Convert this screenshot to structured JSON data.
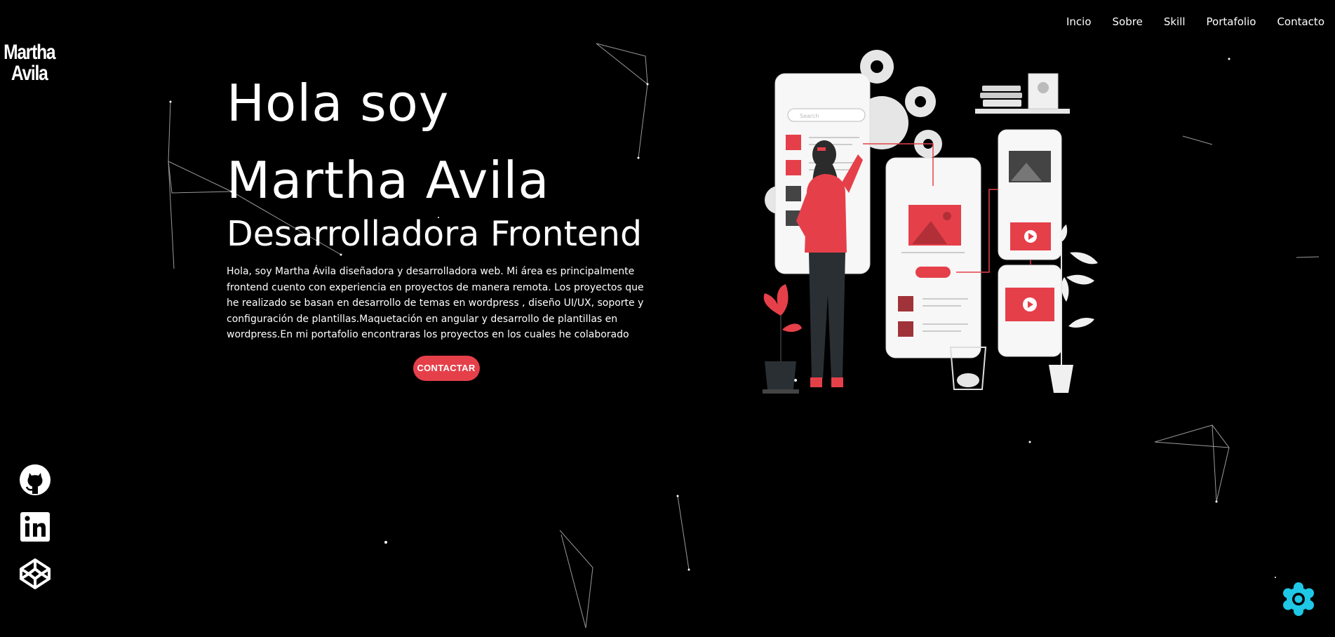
{
  "logo": {
    "line1": "Martha",
    "line2": "Avila"
  },
  "nav": {
    "items": [
      {
        "label": "Incio"
      },
      {
        "label": "Sobre"
      },
      {
        "label": "Skill"
      },
      {
        "label": "Portafolio"
      },
      {
        "label": "Contacto"
      }
    ]
  },
  "hero": {
    "title": "Hola soy Martha Avila",
    "subtitle": "Desarrolladora Frontend",
    "description": "Hola, soy Martha Ávila diseñadora y desarrolladora web. Mi área es principalmente frontend cuento con experiencia en proyectos de manera remota. Los proyectos que he realizado se basan en desarrollo de temas en wordpress , diseño UI/UX, soporte y configuración de plantillas.Maquetación en angular y desarrollo de plantillas en wordpress.En mi portafolio encontraras los proyectos en los cuales he colaborado",
    "cta_label": "CONTACTAR"
  },
  "social": [
    {
      "icon": "github-icon"
    },
    {
      "icon": "linkedin-icon"
    },
    {
      "icon": "codepen-icon"
    }
  ],
  "colors": {
    "background": "#000000",
    "accent": "#e5404a",
    "fab": "#1ec8e6"
  },
  "illustration": {
    "search_text": "Search"
  }
}
